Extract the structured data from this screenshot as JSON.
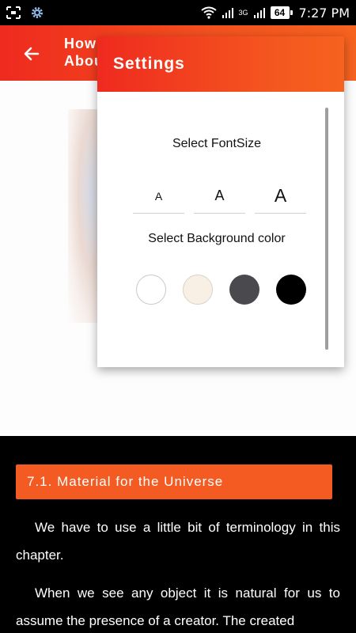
{
  "status_bar": {
    "battery": "64",
    "network": "3G",
    "time": "7:27 PM"
  },
  "app_bar": {
    "title": "How Abou"
  },
  "article": {
    "section_header": "7.1. Material for the Universe",
    "paragraphs": [
      "We have to use a little bit of terminology in this chapter.",
      "When we see any object it is natural for us to assume the presence of a creator. The created"
    ]
  },
  "settings_dialog": {
    "title": "Settings",
    "font_size_label": "Select FontSize",
    "font_options": [
      "A",
      "A",
      "A"
    ],
    "background_label": "Select Background color",
    "background_colors": [
      "#ffffff",
      "#f8f0e5",
      "#4a494e",
      "#000000"
    ]
  },
  "colors": {
    "accent_start": "#ef2a1f",
    "accent_end": "#f6631f",
    "section_header_bg": "#f35b22"
  }
}
